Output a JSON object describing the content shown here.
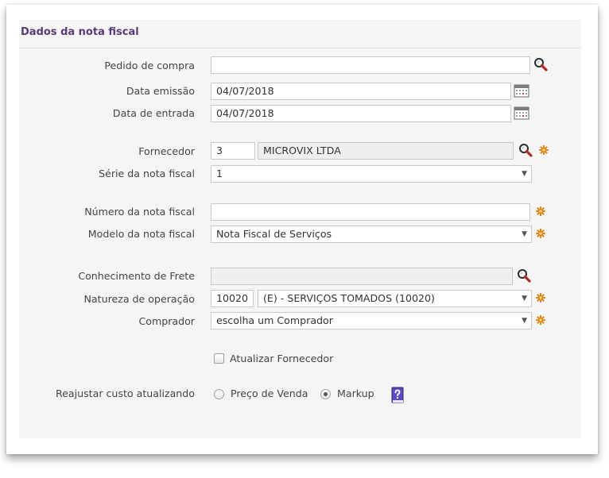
{
  "section_title": "Dados da nota fiscal",
  "fields": {
    "pedido_compra": {
      "label": "Pedido de compra",
      "value": ""
    },
    "data_emissao": {
      "label": "Data emissão",
      "value": "04/07/2018"
    },
    "data_entrada": {
      "label": "Data de entrada",
      "value": "04/07/2018"
    },
    "fornecedor": {
      "label": "Fornecedor",
      "code": "3",
      "name": "MICROVIX LTDA"
    },
    "serie": {
      "label": "Série da nota fiscal",
      "value": "1"
    },
    "numero": {
      "label": "Número da nota fiscal",
      "value": ""
    },
    "modelo": {
      "label": "Modelo da nota fiscal",
      "value": "Nota Fiscal de Serviços"
    },
    "conhecimento_frete": {
      "label": "Conhecimento de Frete",
      "value": ""
    },
    "natureza_operacao": {
      "label": "Natureza de operação",
      "code": "10020",
      "value": "(E) - SERVIÇOS TOMADOS (10020)"
    },
    "comprador": {
      "label": "Comprador",
      "value": "escolha um Comprador"
    }
  },
  "atualizar_fornecedor": {
    "label": "Atualizar Fornecedor",
    "checked": false
  },
  "reajustar": {
    "label": "Reajustar custo atualizando",
    "options": [
      {
        "label": "Preço de Venda",
        "selected": false
      },
      {
        "label": "Markup",
        "selected": true
      }
    ]
  },
  "icons": {
    "search": "search-icon",
    "calendar": "calendar-icon",
    "cog": "cog-icon",
    "help": "help-book-icon"
  },
  "colors": {
    "title": "#5a3a78",
    "panel": "#f5f5f5",
    "cog": "#e08a1e",
    "search": "#c0392b"
  }
}
